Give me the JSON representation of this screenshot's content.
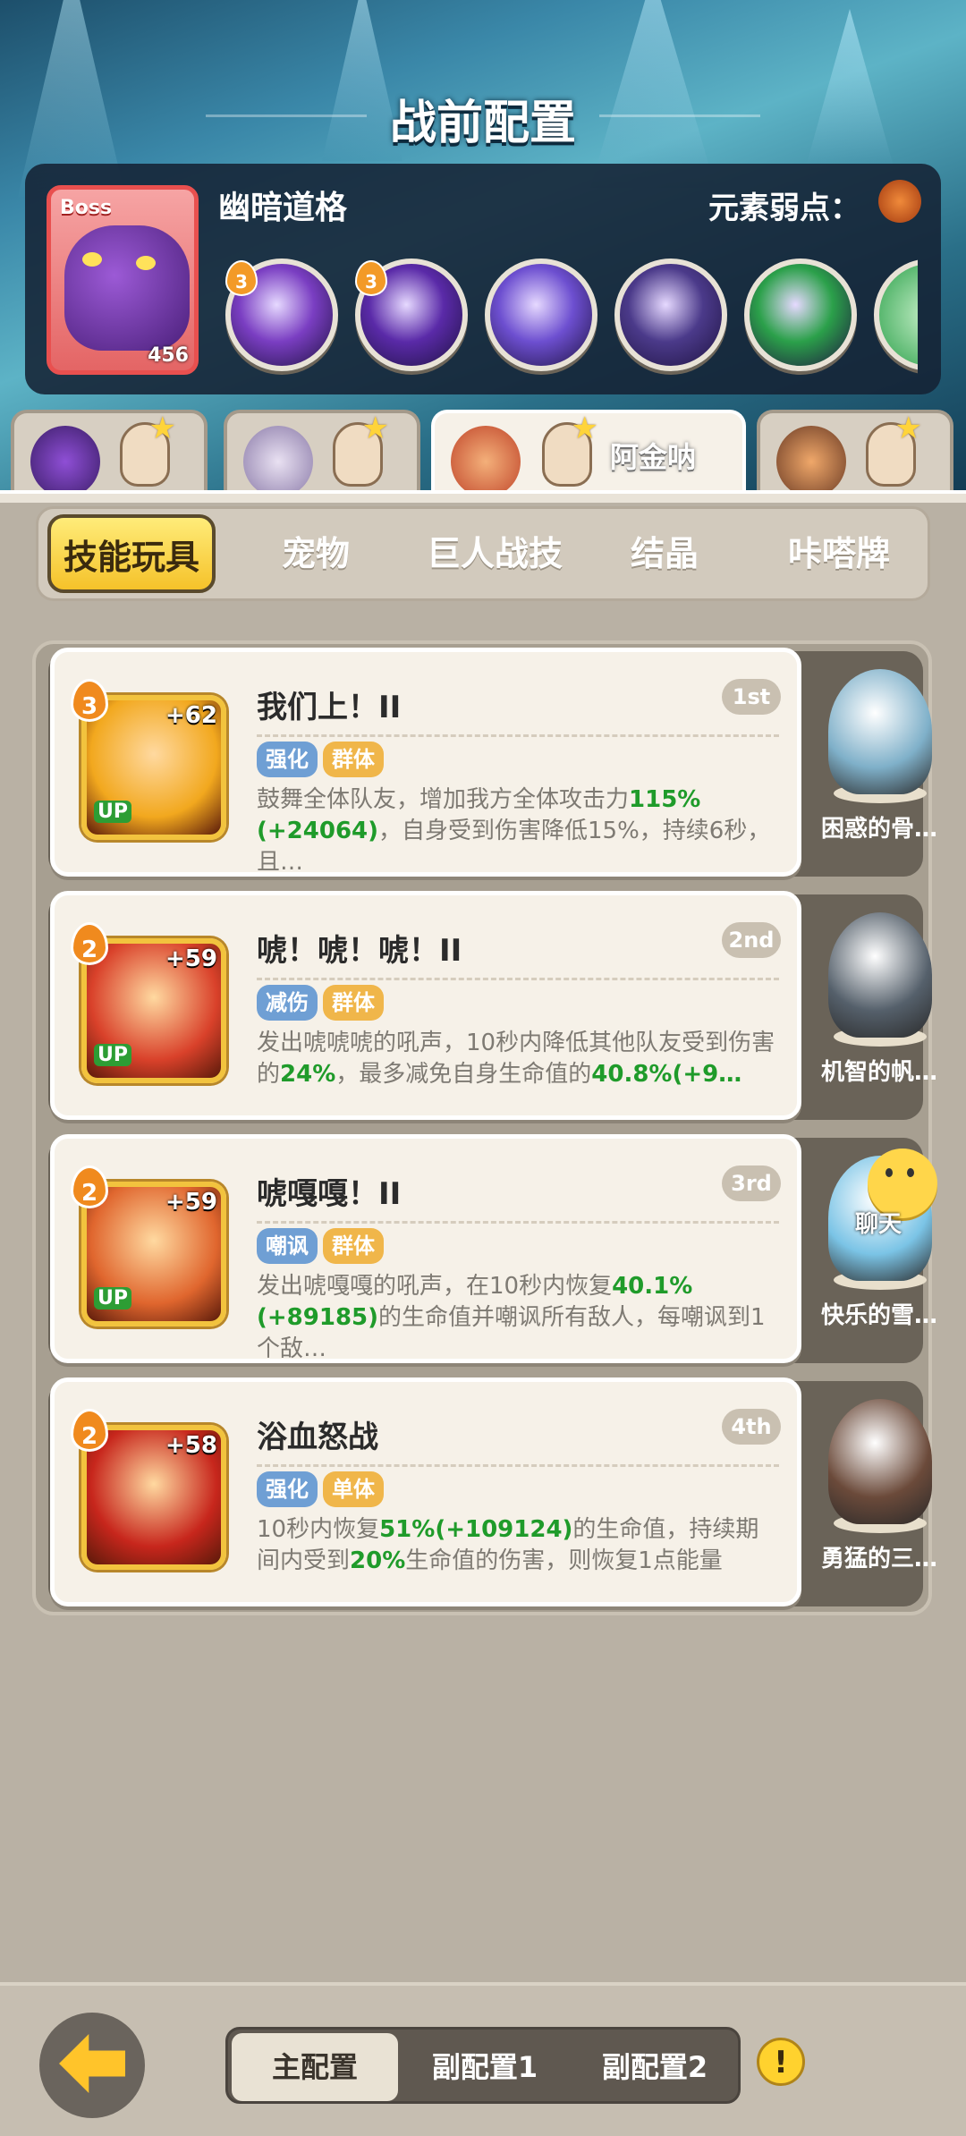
{
  "header": {
    "title": "战前配置"
  },
  "boss": {
    "tag": "Boss",
    "level": "456",
    "name": "幽暗道格",
    "weakness_label": "元素弱点："
  },
  "boss_skills": [
    {
      "badge": "3",
      "color": "#7a3ec2",
      "icon": "purple-swirl-icon"
    },
    {
      "badge": "3",
      "color": "#5a2aa8",
      "icon": "dark-burst-icon"
    },
    {
      "badge": "",
      "color": "#6d4fd0",
      "icon": "crystal-icon"
    },
    {
      "badge": "",
      "color": "#4b3a8a",
      "icon": "shadow-beast-icon"
    },
    {
      "badge": "",
      "color": "#2ba04a",
      "icon": "hourglass-icon"
    }
  ],
  "hero_tabs": [
    {
      "name": "",
      "active": false
    },
    {
      "name": "",
      "active": false
    },
    {
      "name": "阿金呐",
      "active": true
    },
    {
      "name": "",
      "active": false
    }
  ],
  "categories": [
    "技能玩具",
    "宠物",
    "巨人战技",
    "结晶",
    "咔嗒牌"
  ],
  "cards": [
    {
      "level": "3",
      "plus": "+62",
      "up": "UP",
      "title": "我们上！II",
      "rank": "1st",
      "tags": [
        {
          "text": "强化",
          "color": "blue"
        },
        {
          "text": "群体",
          "color": "yellow"
        }
      ],
      "desc": [
        {
          "t": "鼓舞全体队友，增加我方全体攻击力",
          "g": false
        },
        {
          "t": "115%(+24064)",
          "g": true
        },
        {
          "t": "，自身受到伤害降低15%，持续6秒，且…",
          "g": false
        }
      ],
      "icon_color": "#f2a81e",
      "pet": {
        "name": "困惑的骨…",
        "color": "#7fb0c9"
      }
    },
    {
      "level": "2",
      "plus": "+59",
      "up": "UP",
      "title": "唬！唬！唬！II",
      "rank": "2nd",
      "tags": [
        {
          "text": "减伤",
          "color": "blue"
        },
        {
          "text": "群体",
          "color": "yellow"
        }
      ],
      "desc": [
        {
          "t": "发出唬唬唬的吼声，10秒内降低其他队友受到伤害的",
          "g": false
        },
        {
          "t": "24%",
          "g": true
        },
        {
          "t": "，最多减免自身生命值的",
          "g": false
        },
        {
          "t": "40.8%(+9…",
          "g": true
        }
      ],
      "icon_color": "#d9412a",
      "pet": {
        "name": "机智的帆…",
        "color": "#55606b"
      }
    },
    {
      "level": "2",
      "plus": "+59",
      "up": "UP",
      "title": "唬嘎嘎！II",
      "rank": "3rd",
      "tags": [
        {
          "text": "嘲讽",
          "color": "blue"
        },
        {
          "text": "群体",
          "color": "yellow"
        }
      ],
      "desc": [
        {
          "t": "发出唬嘎嘎的吼声，在10秒内恢复",
          "g": false
        },
        {
          "t": "40.1%(+89185)",
          "g": true
        },
        {
          "t": "的生命值并嘲讽所有敌人，每嘲讽到1个敌…",
          "g": false
        }
      ],
      "icon_color": "#e0662e",
      "pet": {
        "name": "快乐的雪…",
        "color": "#7bc4e6"
      }
    },
    {
      "level": "2",
      "plus": "+58",
      "up": "",
      "title": "浴血怒战",
      "rank": "4th",
      "tags": [
        {
          "text": "强化",
          "color": "blue"
        },
        {
          "text": "单体",
          "color": "yellow"
        }
      ],
      "desc": [
        {
          "t": "10秒内恢复",
          "g": false
        },
        {
          "t": "51%(+109124)",
          "g": true
        },
        {
          "t": "的生命值，持续期间内受到",
          "g": false
        },
        {
          "t": "20%",
          "g": true
        },
        {
          "t": "生命值的伤害，则恢复1点能量",
          "g": false
        }
      ],
      "icon_color": "#c7261c",
      "pet": {
        "name": "勇猛的三…",
        "color": "#6b4a3a"
      }
    }
  ],
  "chat": {
    "label": "聊天"
  },
  "configs": [
    "主配置",
    "副配置1",
    "副配置2"
  ],
  "warn": "!"
}
